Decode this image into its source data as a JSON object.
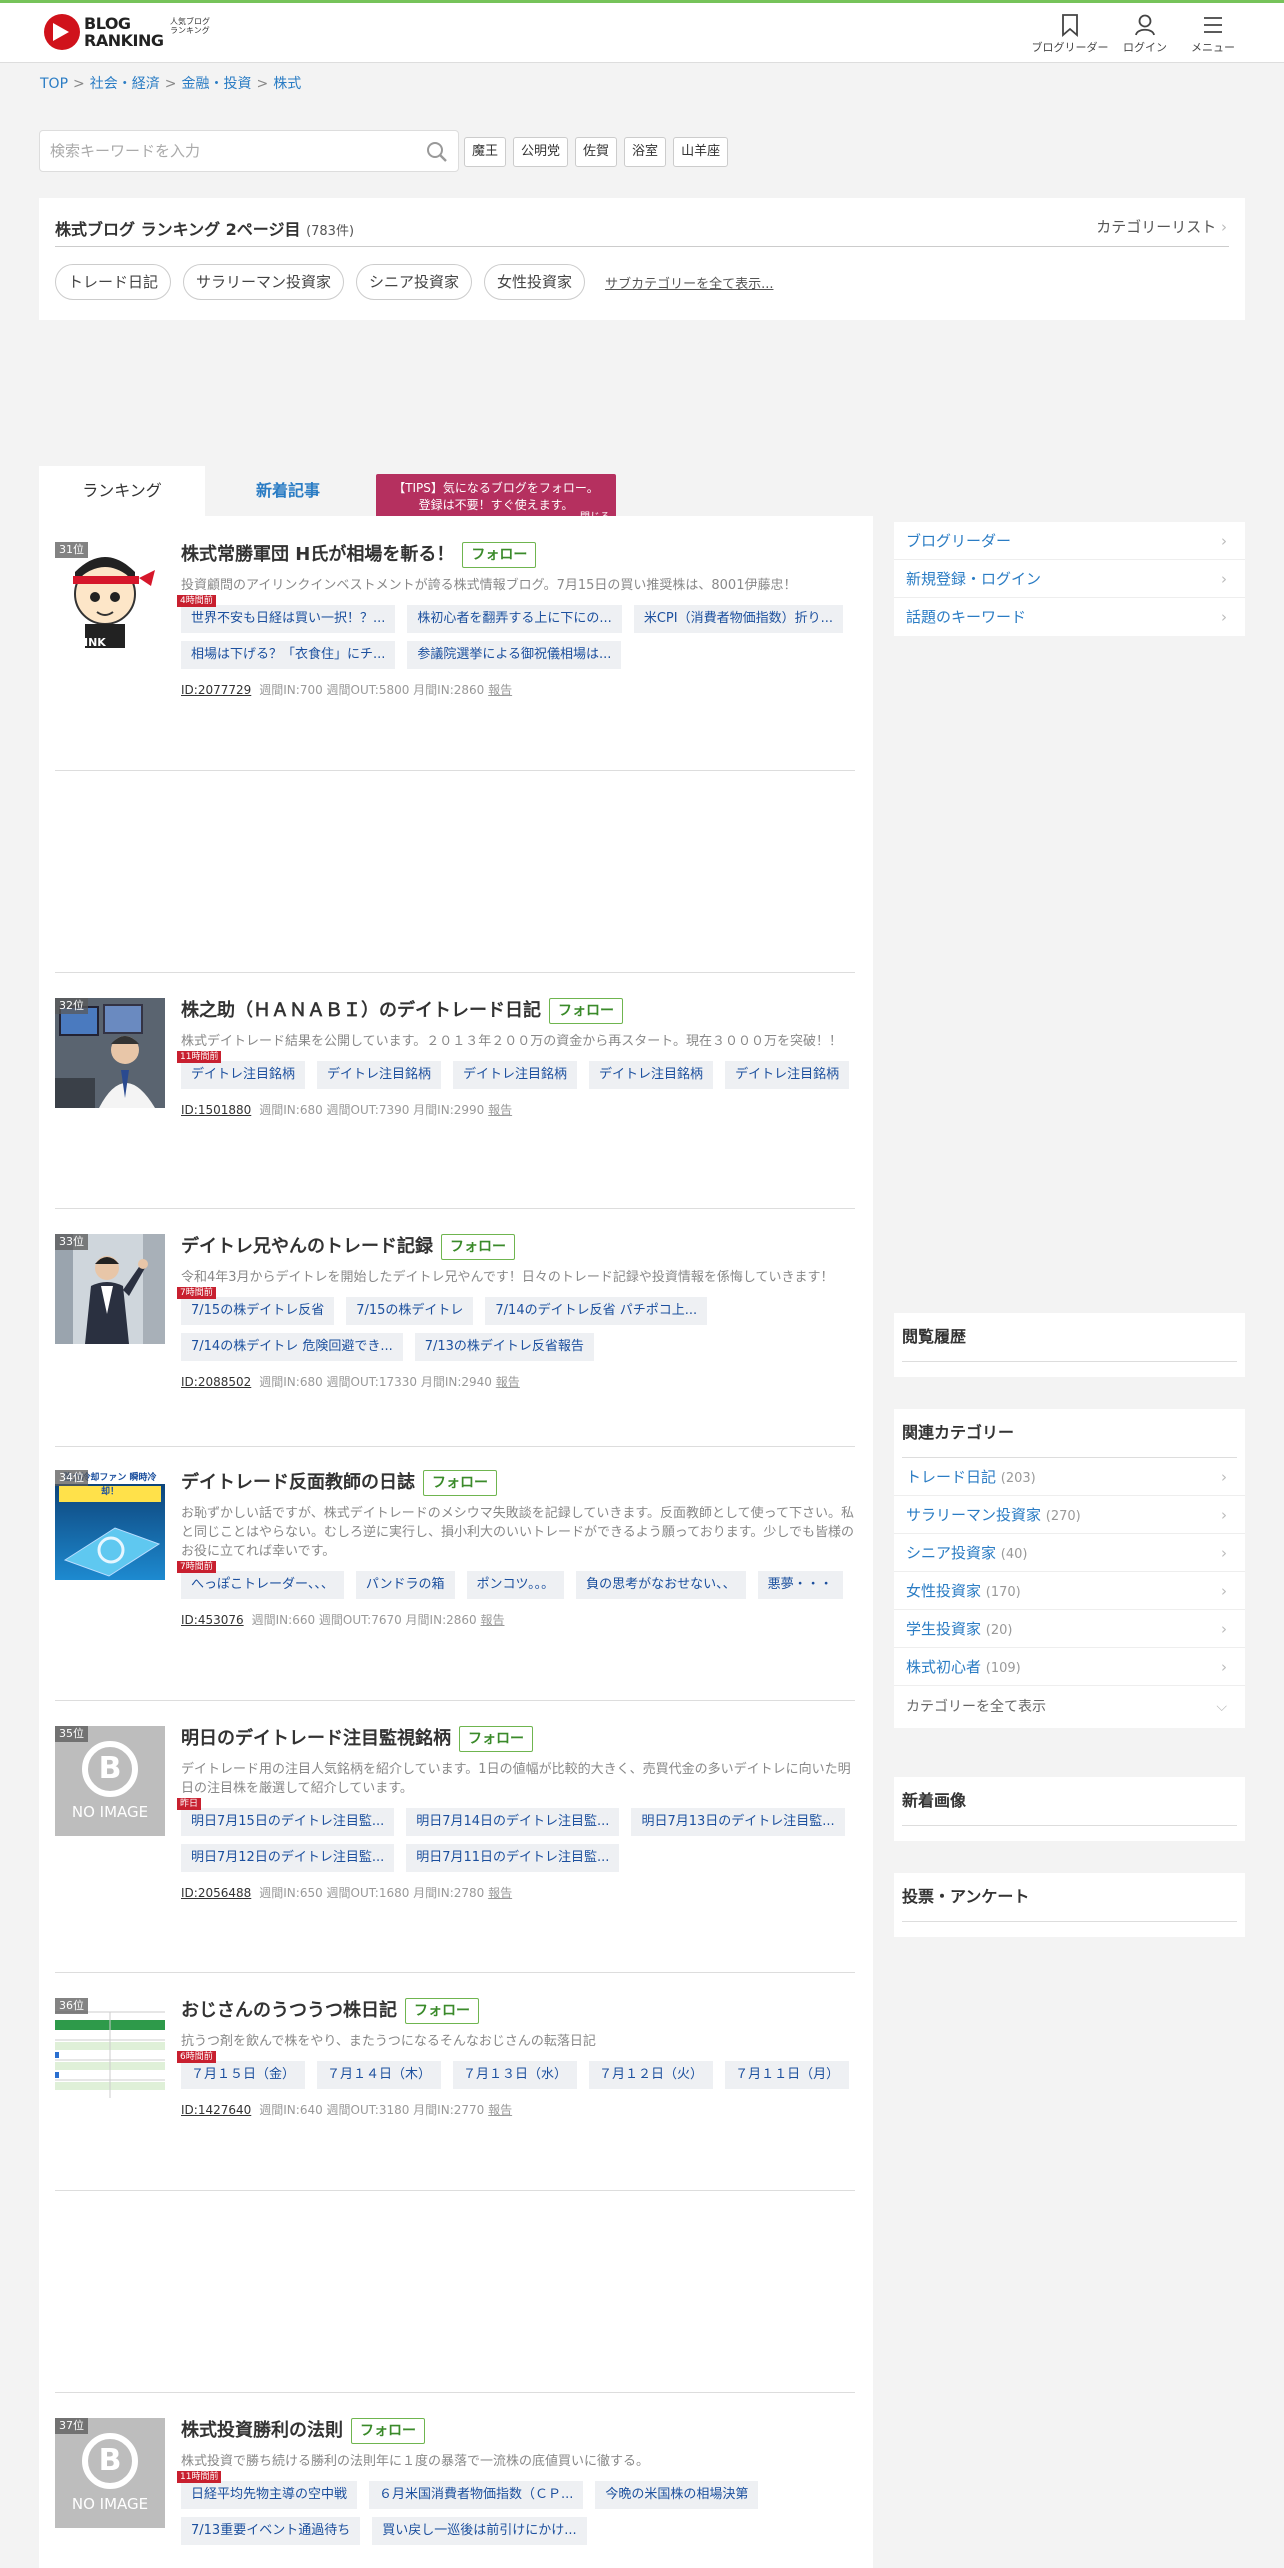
{
  "header": {
    "logo_line1": "BLOG",
    "logo_line2": "RANKING",
    "logo_sub": "人気ブログランキング",
    "nav": [
      {
        "label": "ブログリーダー",
        "icon": "bookmark-icon"
      },
      {
        "label": "ログイン",
        "icon": "user-icon"
      },
      {
        "label": "メニュー",
        "icon": "menu-icon"
      }
    ]
  },
  "breadcrumb": [
    "TOP",
    "社会・経済",
    "金融・投資",
    "株式"
  ],
  "search": {
    "placeholder": "検索キーワードを入力",
    "keywords": [
      "魔王",
      "公明党",
      "佐賀",
      "浴室",
      "山羊座"
    ]
  },
  "category_box": {
    "title": "株式ブログ ランキング 2ページ目",
    "count": "(783件)",
    "list_link": "カテゴリーリスト",
    "chips": [
      "トレード日記",
      "サラリーマン投資家",
      "シニア投資家",
      "女性投資家"
    ],
    "show_all": "サブカテゴリーを全て表示..."
  },
  "tabs": {
    "ranking": "ランキング",
    "new_articles": "新着記事"
  },
  "tips": {
    "line1": "【TIPS】気になるブログをフォロー。",
    "line2": "登録は不要！すぐ使えます。",
    "close": "閉じる"
  },
  "follow_label": "フォロー",
  "report_label": "報告",
  "entries": [
    {
      "rank": "31位",
      "title": "株式常勝軍団 H氏が相場を斬る！",
      "desc": "投資顧問のアイリンクインベストメントが誇る株式情報ブログ。7月15日の買い推奨株は、8001伊藤忠！",
      "ago": "4時間前",
      "posts": [
        "世界不安も日経は買い一択！？...",
        "株初心者を翻弄する上に下にの...",
        "米CPI（消費者物価指数）折り...",
        "相場は下げる？「衣食住」にチ...",
        "参議院選挙による御祝儀相場は..."
      ],
      "id": "ID:2077729",
      "stats": "週間IN:700 週間OUT:5800 月間IN:2860"
    },
    {
      "rank": "32位",
      "title": "株之助（ＨＡＮＡＢＩ）のデイトレード日記",
      "desc": "株式デイトレード結果を公開しています。２０１３年２００万の資金から再スタート。現在３０００万を突破！！",
      "ago": "11時間前",
      "posts": [
        "デイトレ注目銘柄",
        "デイトレ注目銘柄",
        "デイトレ注目銘柄",
        "デイトレ注目銘柄",
        "デイトレ注目銘柄"
      ],
      "id": "ID:1501880",
      "stats": "週間IN:680 週間OUT:7390 月間IN:2990"
    },
    {
      "rank": "33位",
      "title": "デイトレ兄やんのトレード記録",
      "desc": "令和4年3月からデイトレを開始したデイトレ兄やんです！日々のトレード記録や投資情報を係悔していきます！",
      "ago": "7時間前",
      "posts": [
        "7/15の株デイトレ反省",
        "7/15の株デイトレ",
        "7/14のデイトレ反省 パチポコ上...",
        "7/14の株デイトレ 危険回避でき...",
        "7/13の株デイトレ反省報告"
      ],
      "id": "ID:2088502",
      "stats": "週間IN:680 週間OUT:17330 月間IN:2940"
    },
    {
      "rank": "34位",
      "title": "デイトレード反面教師の日誌",
      "desc": "お恥ずかしい話ですが、株式デイトレードのメシウマ失敗談を記録していきます。反面教師として使って下さい。私と同じことはやらない。むしろ逆に実行し、損小利大のいいトレードができるよう願っております。少しでも皆様のお役に立てれば幸いです。",
      "ago": "7時間前",
      "posts": [
        "へっぽこトレーダー、、、",
        "パンドラの箱",
        "ポンコツ。。。",
        "負の思考がなおせない、、",
        "悪夢・・・"
      ],
      "id": "ID:453076",
      "stats": "週間IN:660 週間OUT:7670 月間IN:2860",
      "thumb_text": "強力冷却ファン 瞬時冷却！"
    },
    {
      "rank": "35位",
      "title": "明日のデイトレード注目監視銘柄",
      "desc": "デイトレード用の注目人気銘柄を紹介しています。1日の値幅が比較的大きく、売買代金の多いデイトレに向いた明日の注目株を厳選して紹介しています。",
      "ago": "昨日",
      "posts": [
        "明日7月15日のデイトレ注目監...",
        "明日7月14日のデイトレ注目監...",
        "明日7月13日のデイトレ注目監...",
        "明日7月12日のデイトレ注目監...",
        "明日7月11日のデイトレ注目監..."
      ],
      "id": "ID:2056488",
      "stats": "週間IN:650 週間OUT:1680 月間IN:2780"
    },
    {
      "rank": "36位",
      "title": "おじさんのうつうつ株日記",
      "desc": "抗うつ剤を飲んで株をやり、またうつになるそんなおじさんの転落日記",
      "ago": "6時間前",
      "posts": [
        "７月１５日（金）",
        "７月１４日（木）",
        "７月１３日（水）",
        "７月１２日（火）",
        "７月１１日（月）"
      ],
      "id": "ID:1427640",
      "stats": "週間IN:640 週間OUT:3180 月間IN:2770"
    },
    {
      "rank": "37位",
      "title": "株式投資勝利の法則",
      "desc": "株式投資で勝ち続ける勝利の法則年に１度の暴落で一流株の底値買いに徹する。",
      "ago": "11時間前",
      "posts": [
        "日経平均先物主導の空中戦",
        "６月米国消費者物価指数（ＣＰ...",
        "今晩の米国株の相場決第",
        "7/13重要イベント通過待ち",
        "買い戻し一巡後は前引けにかけ..."
      ]
    }
  ],
  "noimage_text": "NO IMAGE",
  "sidebar": {
    "links": [
      "ブログリーダー",
      "新規登録・ログイン",
      "話題のキーワード"
    ],
    "history_title": "閲覧履歴",
    "related_title": "関連カテゴリー",
    "related": [
      {
        "name": "トレード日記",
        "count": "(203)"
      },
      {
        "name": "サラリーマン投資家",
        "count": "(270)"
      },
      {
        "name": "シニア投資家",
        "count": "(40)"
      },
      {
        "name": "女性投資家",
        "count": "(170)"
      },
      {
        "name": "学生投資家",
        "count": "(20)"
      },
      {
        "name": "株式初心者",
        "count": "(109)"
      }
    ],
    "show_all_categories": "カテゴリーを全て表示",
    "new_images_title": "新着画像",
    "vote_title": "投票・アンケート"
  }
}
